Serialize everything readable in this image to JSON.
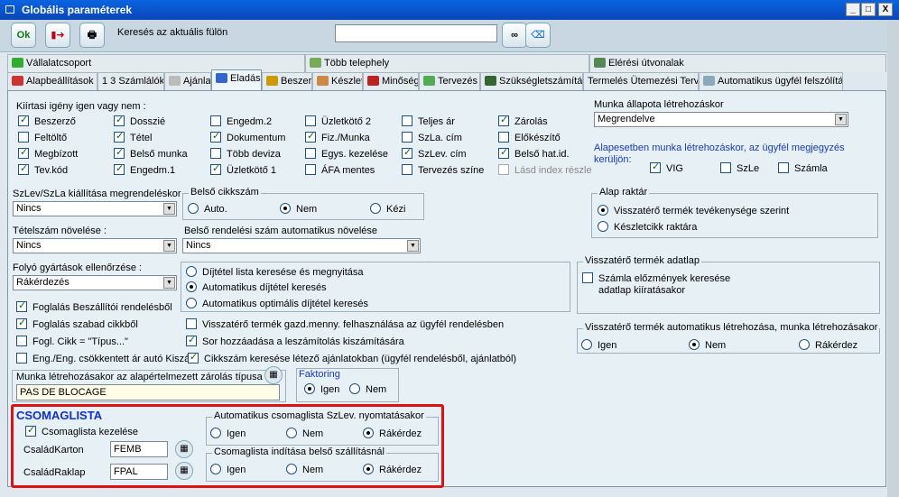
{
  "window": {
    "title": "Globális paraméterek",
    "minimize": "_",
    "maximize": "□",
    "close": "X"
  },
  "toolbar": {
    "ok_label": "Ok",
    "search_label": "Keresés az aktuális fülön",
    "search_value": ""
  },
  "tabs_row1": [
    "Vállalatcsoport",
    "Több telephely",
    "Elérési útvonalak"
  ],
  "tabs_row2": [
    "Alapbeállítások",
    "1 3 Számlálók",
    "Ajánlat",
    "Eladás",
    "Beszer.",
    "Készlet",
    "Minőség",
    "Tervezés",
    "Szükségletszámítás",
    "Termelés Ütemezési Terv",
    "Automatikus ügyfél felszólítás"
  ],
  "kiirtasi": {
    "title": "Kiírtasi igény igen vagy nem :",
    "items": [
      [
        "Beszerző",
        true
      ],
      [
        "Dosszié",
        true
      ],
      [
        "Engedm.2",
        false
      ],
      [
        "Üzletkötő 2",
        false
      ],
      [
        "Teljes ár",
        false
      ],
      [
        "Zárolás",
        true
      ],
      [
        "Feltöltő",
        false
      ],
      [
        "Tétel",
        true
      ],
      [
        "Dokumentum",
        true
      ],
      [
        "Fiz./Munka",
        true
      ],
      [
        "SzLa. cím",
        false
      ],
      [
        "Előkészítő",
        false
      ],
      [
        "Megbízott",
        true
      ],
      [
        "Belső munka",
        true
      ],
      [
        "Több deviza",
        false
      ],
      [
        "Egys. kezelése",
        false
      ],
      [
        "SzLev. cím",
        true
      ],
      [
        "Belső hat.id.",
        true
      ],
      [
        "Tev.kód",
        true
      ],
      [
        "Engedm.1",
        true
      ],
      [
        "Üzletkötő 1",
        true
      ],
      [
        "ÁFA mentes",
        false
      ],
      [
        "Tervezés színe",
        false
      ],
      [
        "Lásd index részle",
        false
      ]
    ]
  },
  "munka_allapota": {
    "label": "Munka állapota létrehozáskor",
    "value": "Megrendelve"
  },
  "megjegyzes": {
    "label": "Alapesetben munka létrehozáskor, az ügyfél megjegyzés kerüljön:",
    "vig": "VIG",
    "szle": "SzLe",
    "szamla": "Számla"
  },
  "szlev_kiallitasa": {
    "label": "SzLev/SzLa kiállítása megrendeléskor",
    "value": "Nincs"
  },
  "belso_cikkszam": {
    "label": "Belső cikkszám",
    "auto": "Auto.",
    "nem": "Nem",
    "kezi": "Kézi"
  },
  "alap_raktar": {
    "label": "Alap raktár",
    "opt1": "Visszatérő termék tevékenysége szerint",
    "opt2": "Készletcikk raktára"
  },
  "tetelszam": {
    "label": "Tételszám növelése :",
    "value": "Nincs"
  },
  "belso_rendelesi": {
    "label": "Belső rendelési szám automatikus növelése",
    "value": "Nincs"
  },
  "folyo_gyartasok": {
    "label": "Folyó gyártások ellenőrzése :",
    "value": "Rákérdezés"
  },
  "dijtetel": {
    "opt1": "Díjtétel lista keresése és megnyitása",
    "opt2": "Automatikus díjtétel keresés",
    "opt3": "Automatikus optimális díjtétel keresés"
  },
  "visszatero_adatlap": {
    "label": "Visszatérő termék adatlap",
    "cb_line1": "Számla előzmények keresése",
    "cb_line2": "adatlap kiíratásakor"
  },
  "visszatero_auto": {
    "label": "Visszatérő termék automatikus létrehozása, munka létrehozásakor",
    "igen": "Igen",
    "nem": "Nem",
    "rakerdez": "Rákérdez"
  },
  "left_checks": [
    "Foglalás Beszállítói rendelésből",
    "Foglalás szabad cikkből",
    "Fogl. Cikk = \"Típus...\"",
    "Eng./Eng. csökkentett ár autó Kiszá"
  ],
  "mid_checks": [
    "Visszatérő termék gazd.menny. felhasználása az ügyfél rendelésben",
    "Sor hozzáadása a leszámítolás kiszámítására",
    "Cikkszám keresése létező ajánlatokban (ügyfél rendelésből, ajánlatból)"
  ],
  "munka_zarolas": {
    "label": "Munka létrehozásakor az alapértelmezett zárolás típusa",
    "value": "PAS DE BLOCAGE"
  },
  "faktoring": {
    "label": "Faktoring",
    "igen": "Igen",
    "nem": "Nem"
  },
  "csomaglista": {
    "title": "CSOMAGLISTA",
    "kezeles": "Csomaglista kezelése",
    "karton_label": "CsaládKarton",
    "karton_value": "FEMB",
    "raklap_label": "CsaládRaklap",
    "raklap_value": "FPAL",
    "auto_label": "Automatikus csomaglista SzLev. nyomtatásakor",
    "belso_label": "Csomaglista indítása belső szállításnál",
    "igen": "Igen",
    "nem": "Nem",
    "rakerdez": "Rákérdez"
  },
  "colors": {
    "titlebar": "#0846b8",
    "panel": "#e6f0f5",
    "highlight": "#d11111",
    "section_title": "#1030c8"
  }
}
